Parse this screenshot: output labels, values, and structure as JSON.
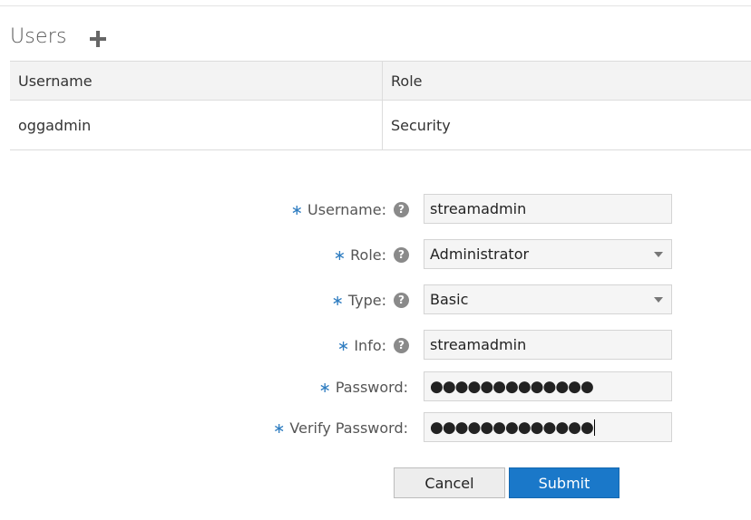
{
  "section": {
    "title": "Users",
    "add_icon": "plus-icon"
  },
  "table": {
    "columns": [
      "Username",
      "Role"
    ],
    "rows": [
      {
        "username": "oggadmin",
        "role": "Security"
      }
    ]
  },
  "form": {
    "required_marker": "∗",
    "help_glyph": "?",
    "username": {
      "label": "Username:",
      "value": "streamadmin"
    },
    "role": {
      "label": "Role:",
      "value": "Administrator"
    },
    "type": {
      "label": "Type:",
      "value": "Basic"
    },
    "info": {
      "label": "Info:",
      "value": "streamadmin"
    },
    "password": {
      "label": "Password:",
      "value": "●●●●●●●●●●●●●"
    },
    "verify_password": {
      "label": "Verify Password:",
      "value": "●●●●●●●●●●●●●"
    }
  },
  "buttons": {
    "cancel": "Cancel",
    "submit": "Submit"
  },
  "colors": {
    "accent": "#1a78c9",
    "required": "#2f7dc1"
  }
}
